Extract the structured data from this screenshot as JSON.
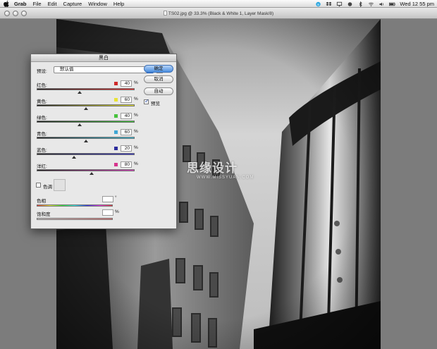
{
  "menubar": {
    "app_name": "Grab",
    "items": [
      "File",
      "Edit",
      "Capture",
      "Window",
      "Help"
    ],
    "clock": "Wed 12 55 pm",
    "status_icons": [
      "skype-icon",
      "dropbox-icon",
      "monitor-icon",
      "record-icon",
      "bluetooth-icon",
      "wifi-icon",
      "volume-icon",
      "battery-icon"
    ]
  },
  "document": {
    "title": "TS02.jpg @ 33.3% (Black & White 1, Layer Mask/8)"
  },
  "watermark": {
    "text": "思缘设计",
    "url": "WWW.MISSYUAN.COM"
  },
  "dialog": {
    "title": "黑白",
    "preset_label": "预设:",
    "preset_value": "默认值",
    "buttons": {
      "ok": "确定",
      "cancel": "取消",
      "auto": "自动"
    },
    "preview_label": "预览",
    "preview_checked": true,
    "channels": [
      {
        "label": "红色:",
        "value": "40",
        "unit": "%",
        "color": "#cf2a2a",
        "gradient": [
          "#1a1a1a",
          "#ff2a2a"
        ],
        "position": 0.44
      },
      {
        "label": "黄色:",
        "value": "60",
        "unit": "%",
        "color": "#e8e234",
        "gradient": [
          "#1a1a1a",
          "#f2ee2a"
        ],
        "position": 0.5
      },
      {
        "label": "绿色:",
        "value": "40",
        "unit": "%",
        "color": "#46c23c",
        "gradient": [
          "#1a1a1a",
          "#3ed13a"
        ],
        "position": 0.44
      },
      {
        "label": "青色:",
        "value": "60",
        "unit": "%",
        "color": "#3fa6d4",
        "gradient": [
          "#1a1a1a",
          "#36c8e8"
        ],
        "position": 0.5
      },
      {
        "label": "蓝色:",
        "value": "20",
        "unit": "%",
        "color": "#2c2c9c",
        "gradient": [
          "#1a1a1a",
          "#3535d8"
        ],
        "position": 0.38
      },
      {
        "label": "洋红:",
        "value": "80",
        "unit": "%",
        "color": "#d7348d",
        "gradient": [
          "#1a1a1a",
          "#e640c8"
        ],
        "position": 0.56
      }
    ],
    "tint_label": "色调",
    "tint_checked": false,
    "hue_label": "色相",
    "hue_unit": "°",
    "saturation_label": "饱和度",
    "saturation_unit": "%"
  }
}
